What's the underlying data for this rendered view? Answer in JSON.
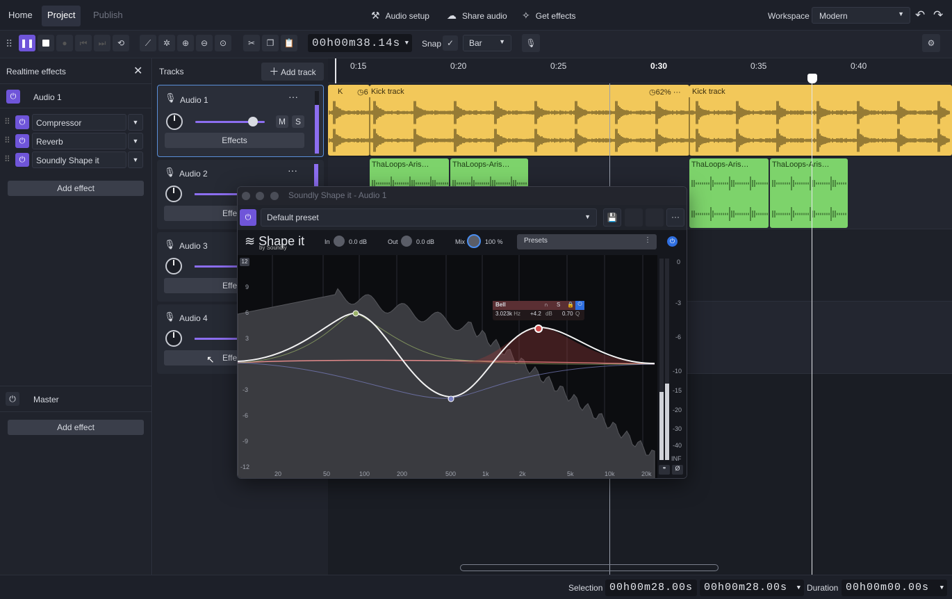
{
  "nav": {
    "home": "Home",
    "project": "Project",
    "publish": "Publish",
    "audio_setup": "Audio setup",
    "share_audio": "Share audio",
    "get_effects": "Get effects",
    "workspace_label": "Workspace",
    "workspace_value": "Modern"
  },
  "toolbar": {
    "time": "00h00m38.14s",
    "snap_label": "Snap",
    "snap_value": "Bar"
  },
  "left_panel": {
    "title": "Realtime effects",
    "track_name": "Audio 1",
    "effects": [
      "Compressor",
      "Reverb",
      "Soundly Shape it"
    ],
    "add_effect": "Add effect",
    "master_label": "Master",
    "master_add_effect": "Add effect"
  },
  "tracks_panel": {
    "title": "Tracks",
    "add_track": "Add track",
    "tracks": [
      {
        "name": "Audio 1",
        "effects": "Effects",
        "mute": "M",
        "solo": "S"
      },
      {
        "name": "Audio 2",
        "effects": "Effe"
      },
      {
        "name": "Audio 3",
        "effects": "Effe"
      },
      {
        "name": "Audio 4",
        "effects": "Effe"
      }
    ]
  },
  "ruler": {
    "ticks": [
      "0:15",
      "0:20",
      "0:25",
      "0:30",
      "0:35",
      "0:40"
    ]
  },
  "clips": {
    "kick_short": "K",
    "kick_loop1": "6",
    "kick_title": "Kick track",
    "kick_loop2": "62%",
    "kick_title2": "Kick track",
    "green": [
      "ThaLoops-Aris…",
      "ThaLoops-Aris…",
      "ThaLoops-Aris…",
      "ThaLoops-Aris…"
    ]
  },
  "plugin": {
    "title": "Soundly Shape it - Audio 1",
    "preset": "Default preset",
    "brand": "Shape it",
    "brand_sub": "by Soundly",
    "in_label": "In",
    "in_value": "0.0 dB",
    "out_label": "Out",
    "out_value": "0.0 dB",
    "mix_label": "Mix",
    "mix_value": "100 %",
    "presets": "Presets",
    "band_type": "Bell",
    "band_s": "S",
    "band_freq": "3.023k",
    "band_freq_unit": "Hz",
    "band_gain": "+4.2",
    "band_gain_unit": "dB",
    "band_q": "0.70",
    "band_q_unit": "Q",
    "y_labels": [
      "12",
      "9",
      "6",
      "3",
      "-3",
      "-6",
      "-9",
      "-12"
    ],
    "x_labels": [
      "20",
      "50",
      "100",
      "200",
      "500",
      "1k",
      "2k",
      "5k",
      "10k",
      "20k"
    ],
    "meter_labels": [
      "0",
      "-3",
      "-6",
      "-10",
      "-15",
      "-20",
      "-30",
      "-40",
      "INF"
    ]
  },
  "bottom": {
    "selection_label": "Selection",
    "sel_start": "00h00m28.00s",
    "sel_end": "00h00m28.00s",
    "duration_label": "Duration",
    "duration": "00h00m00.00s"
  },
  "colors": {
    "accent": "#6f55d9",
    "kick": "#f2c85a",
    "loop": "#7dd36b"
  }
}
